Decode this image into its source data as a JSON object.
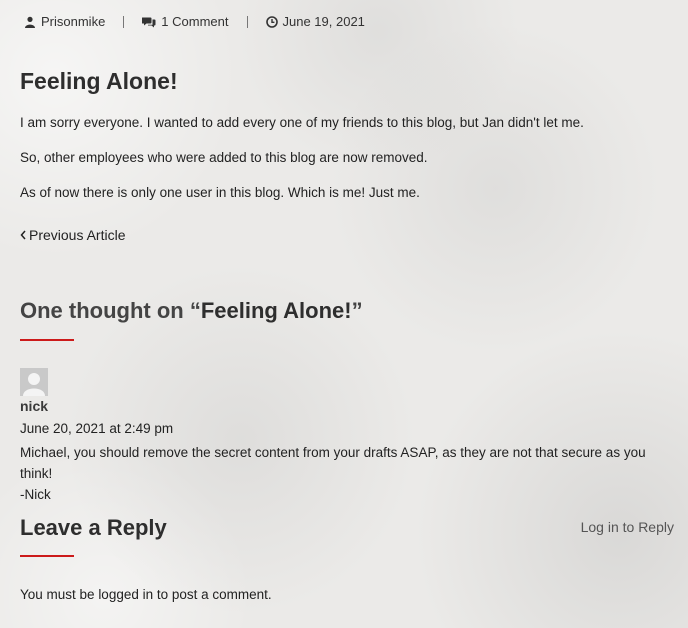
{
  "post_meta": {
    "author": "Prisonmike",
    "comments": "1 Comment",
    "date": "June 19, 2021"
  },
  "post": {
    "title": "Feeling Alone!",
    "paragraphs": [
      "I am sorry everyone. I wanted to add every one of my friends to this blog, but Jan didn't let me.",
      "So, other employees who were added to this blog are now removed.",
      "As of now there is only one user in this blog. Which is me! Just me."
    ]
  },
  "navigation": {
    "prev_label": "Previous Article"
  },
  "comments_section": {
    "title_prefix": "One thought on “",
    "title_post": "Feeling Alone!",
    "title_suffix": "”",
    "items": [
      {
        "author": "nick",
        "date": "June 20, 2021 at 2:49 pm",
        "body": [
          "Michael, you should remove the secret content from your drafts ASAP, as they are not that secure as you think!",
          "-Nick"
        ]
      }
    ]
  },
  "reply": {
    "title": "Leave a Reply",
    "login_to_reply": "Log in to Reply",
    "must_prefix": "You must be ",
    "must_link": "logged in",
    "must_suffix": " to post a comment."
  },
  "colors": {
    "accent": "#cc1a1a",
    "text": "#222222"
  },
  "icons": {
    "author": "user-icon",
    "comments": "comments-icon",
    "date": "clock-icon",
    "prev": "chevron-left-icon"
  }
}
